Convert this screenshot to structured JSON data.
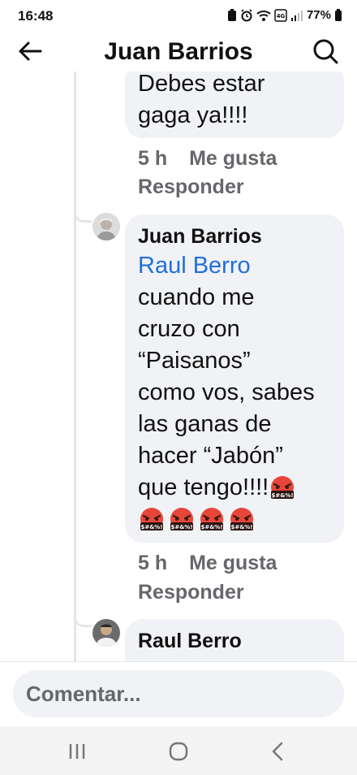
{
  "status": {
    "time": "16:48",
    "battery": "77%",
    "icons": [
      "battery-saver-icon",
      "alarm-icon",
      "wifi-icon",
      "volte-icon",
      "signal-icon",
      "battery-icon"
    ]
  },
  "header": {
    "title": "Juan Barrios",
    "back_icon": "arrow-left-icon",
    "search_icon": "search-icon"
  },
  "comments": [
    {
      "text_lines": [
        "Debes estar",
        "gaga ya!!!!"
      ],
      "time": "5 h",
      "like_label": "Me gusta",
      "reply_label": "Responder"
    },
    {
      "author": "Juan Barrios",
      "mention": "Raul Berro",
      "text_lines": [
        "cuando me",
        "cruzo con",
        "“Paisanos”",
        "como vos, sabes",
        "las ganas de",
        "hacer “Jabón”",
        "que tengo!!!!"
      ],
      "emoji_name": "face-with-symbols-on-mouth",
      "emoji_count_total": 5,
      "time": "5 h",
      "like_label": "Me gusta",
      "reply_label": "Responder"
    },
    {
      "author": "Raul Berro"
    }
  ],
  "composer": {
    "placeholder": "Comentar..."
  },
  "nav": {
    "icons": [
      "recent-apps-icon",
      "home-icon",
      "back-icon"
    ]
  }
}
